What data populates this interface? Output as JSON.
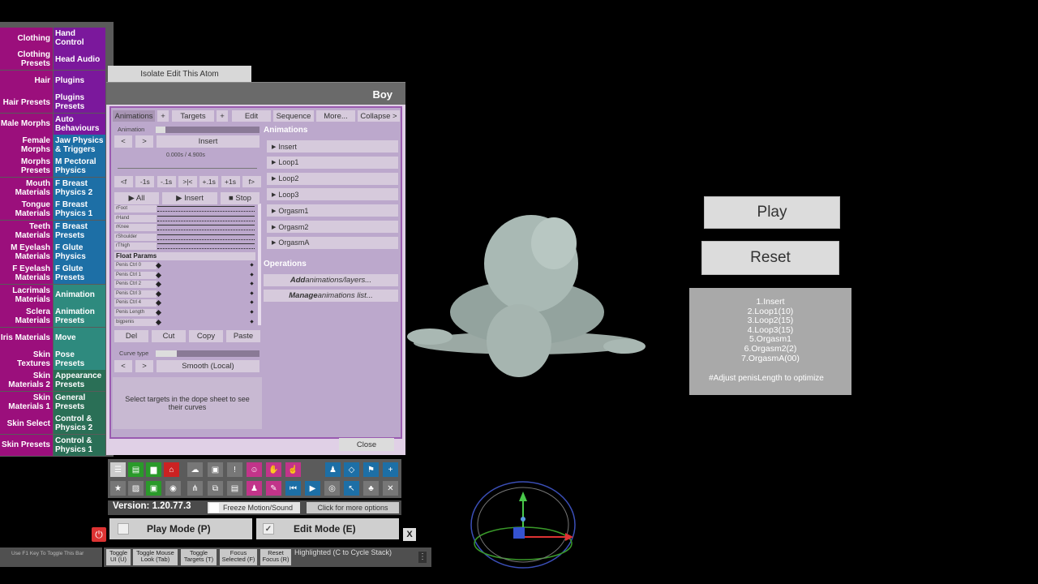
{
  "left_tabs": [
    {
      "left": "Clothing",
      "right": "Hand Control"
    },
    {
      "left": "Clothing Presets",
      "right": "Head Audio"
    },
    {
      "left": "Hair",
      "right": "Plugins"
    },
    {
      "left": "Hair Presets",
      "right": "Plugins Presets"
    },
    {
      "left": "Male Morphs",
      "right": "Auto Behaviours"
    },
    {
      "left": "Female Morphs",
      "right": "Jaw Physics & Triggers"
    },
    {
      "left": "Morphs Presets",
      "right": "M Pectoral Physics"
    },
    {
      "left": "Mouth Materials",
      "right": "F Breast Physics 2"
    },
    {
      "left": "Tongue Materials",
      "right": "F Breast Physics 1"
    },
    {
      "left": "Teeth Materials",
      "right": "F Breast Presets"
    },
    {
      "left": "M Eyelash Materials",
      "right": "F Glute Physics"
    },
    {
      "left": "F Eyelash Materials",
      "right": "F Glute Presets"
    },
    {
      "left": "Lacrimals Materials",
      "right": "Animation"
    },
    {
      "left": "Sclera Materials",
      "right": "Animation Presets"
    },
    {
      "left": "Iris Materials",
      "right": "Move"
    },
    {
      "left": "Skin Textures",
      "right": "Pose Presets"
    },
    {
      "left": "Skin Materials 2",
      "right": "Appearance Presets"
    },
    {
      "left": "Skin Materials 1",
      "right": "General Presets"
    },
    {
      "left": "Skin Select",
      "right": "Control & Physics 2"
    },
    {
      "left": "Skin Presets",
      "right": "Control & Physics 1"
    }
  ],
  "isolate_button": "Isolate Edit This Atom",
  "panel_title": "Boy",
  "top_tabs": [
    "Animations",
    "+",
    "Targets",
    "+",
    "Edit",
    "Sequence",
    "More...",
    "Collapse >"
  ],
  "animation_label": "Animation",
  "nav": {
    "prev": "<",
    "next": ">",
    "insert": "Insert"
  },
  "time_text": "0.000s / 4.900s",
  "step_buttons": [
    "<f",
    "-1s",
    "-.1s",
    ">|<",
    "+.1s",
    "+1s",
    "f>"
  ],
  "play_buttons": [
    "▶ All",
    "▶ Insert",
    "■ Stop"
  ],
  "tracks": [
    "rFoot",
    "rHand",
    "rKnee",
    "rShoulder",
    "rThigh"
  ],
  "float_params_label": "Float Params",
  "float_tracks": [
    "Penis Ctrl 0",
    "Penis Ctrl 1",
    "Penis Ctrl 2",
    "Penis Ctrl 3",
    "Penis Ctrl 4",
    "Penis Length",
    "bigpenis"
  ],
  "edit_buttons": [
    "Del",
    "Cut",
    "Copy",
    "Paste"
  ],
  "curve_type_label": "Curve type",
  "curve_value": "Smooth (Local)",
  "select_hint": "Select targets in the dope sheet to see their curves",
  "animations_heading": "Animations",
  "animations": [
    "Insert",
    "Loop1",
    "Loop2",
    "Loop3",
    "Orgasm1",
    "Orgasm2",
    "OrgasmA"
  ],
  "operations_heading": "Operations",
  "ops": {
    "add_em": "Add",
    "add_rest": " animations/layers...",
    "manage_em": "Manage",
    "manage_rest": " animations list..."
  },
  "close": "Close",
  "version": "Version: 1.20.77.3",
  "freeze": "Freeze Motion/Sound",
  "more_options": "Click for more options",
  "play_mode": "Play Mode (P)",
  "edit_mode": "Edit Mode (E)",
  "x_button": "X",
  "f1_hint": "Use F1 Key To Toggle This Bar",
  "bottom_buttons": [
    "Toggle UI (U)",
    "Toggle Mouse Look (Tab)",
    "Toggle Targets (T)",
    "Focus Selected (F)",
    "Reset Focus (R)"
  ],
  "highlighted": "Highlighted (C to Cycle Stack)",
  "right_play": "Play",
  "right_reset": "Reset",
  "sequence_list": [
    "1.Insert",
    "2.Loop1(10)",
    "3.Loop2(15)",
    "4.Loop3(15)",
    "5.Orgasm1",
    "6.Orgasm2(2)",
    "7.OrgasmA(00)"
  ],
  "adjust_hint": "#Adjust penisLength to optimize",
  "colors": {
    "magenta": "#9b0f7c",
    "purple": "#7b189c",
    "blue": "#1d6fa6",
    "teal": "#2e8a7e",
    "green": "#2a6f56"
  }
}
